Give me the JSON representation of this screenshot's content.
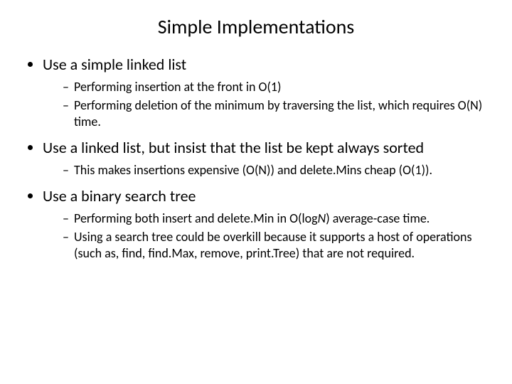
{
  "title": "Simple Implementations",
  "b1": {
    "text": "Use a simple linked list",
    "s1": "Performing insertion at the front in O(1)",
    "s2": "Performing deletion of the minimum by traversing the list, which requires O(N) time."
  },
  "b2": {
    "text": "Use a linked list, but insist that the list be kept always sorted",
    "s1a": "This makes insertions expensive (O(N)) and ",
    "s1b": "delete.Min",
    "s1c": "s cheap (O(1))."
  },
  "b3": {
    "text": "Use a binary search tree",
    "s1a": "Performing both ",
    "s1b": "insert",
    "s1c": " and ",
    "s1d": "delete.Min",
    "s1e": " in O(log",
    "s1f": "N",
    "s1g": ") average-case time.",
    "s2a": "Using a search tree could be overkill because it supports a host of operations (such as, ",
    "s2b": "find, find.Max, remove, print.Tree",
    "s2c": ") that are not required."
  }
}
